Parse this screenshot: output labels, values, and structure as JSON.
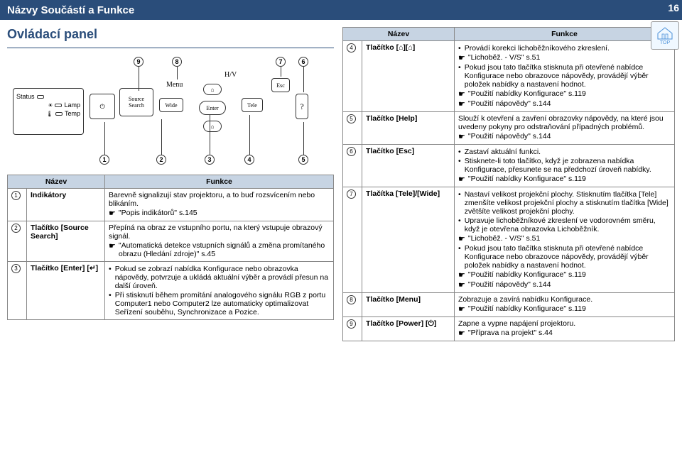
{
  "header": {
    "title": "Názvy Součástí a Funkce",
    "page": "16",
    "top_label": "TOP"
  },
  "section": {
    "title": "Ovládací panel"
  },
  "diagram": {
    "status": "Status",
    "lamp": "Lamp",
    "temp": "Temp",
    "source_search": "Source\nSearch",
    "menu": "Menu",
    "hv": "H/V",
    "wide": "Wide",
    "enter": "Enter",
    "tele": "Tele",
    "esc": "Esc",
    "help": "?"
  },
  "table_headers": {
    "name": "Název",
    "func": "Funkce"
  },
  "left_rows": [
    {
      "num": "1",
      "name": "Indikátory",
      "text": "Barevně signalizují stav projektoru, a to buď rozsvícením nebo blikáním.",
      "ref": "\"Popis indikátorů\" s.145"
    },
    {
      "num": "2",
      "name": "Tlačítko [Source Search]",
      "text": "Přepíná na obraz ze vstupního portu, na který vstupuje obrazový signál.",
      "ref": "\"Automatická detekce vstupních signálů a změna promítaného obrazu (Hledání zdroje)\" s.45"
    },
    {
      "num": "3",
      "name": "Tlačítko [Enter] [↵]",
      "b1": "Pokud se zobrazí nabídka Konfigurace nebo obrazovka nápovědy, potvrzuje a ukládá aktuální výběr a provádí přesun na další úroveň.",
      "b2": "Při stisknutí během promítání analogového signálu RGB z portu Computer1 nebo Computer2 lze automaticky optimalizovat Seřízení souběhu, Synchronizace a Pozice."
    }
  ],
  "right_rows": [
    {
      "num": "4",
      "name": "Tlačítko [⌂][⌂]",
      "b1": "Provádí korekci lichoběžníkového zkreslení.",
      "r1": "\"Lichoběž. - V/S\" s.51",
      "b2": "Pokud jsou tato tlačítka stisknuta při otevřené nabídce Konfigurace nebo obrazovce nápovědy, provádějí výběr položek nabídky a nastavení hodnot.",
      "r2": "\"Použití nabídky Konfigurace\" s.119",
      "r3": "\"Použití nápovědy\" s.144"
    },
    {
      "num": "5",
      "name": "Tlačítko [Help]",
      "text": "Slouží k otevření a zavření obrazovky nápovědy, na které jsou uvedeny pokyny pro odstraňování případných problémů.",
      "r1": "\"Použití nápovědy\" s.144"
    },
    {
      "num": "6",
      "name": "Tlačítko [Esc]",
      "b1": "Zastaví aktuální funkci.",
      "b2": "Stisknete-li toto tlačítko, když je zobrazena nabídka Konfigurace, přesunete se na předchozí úroveň nabídky.",
      "r1": "\"Použití nabídky Konfigurace\" s.119"
    },
    {
      "num": "7",
      "name": "Tlačítka [Tele]/[Wide]",
      "b1": "Nastaví velikost projekční plochy. Stisknutím tlačítka [Tele] zmenšíte velikost projekční plochy a stisknutím tlačítka [Wide] zvětšíte velikost projekční plochy.",
      "b2": "Upravuje lichoběžníkové zkreslení ve vodorovném směru, když je otevřena obrazovka Lichoběžník.",
      "r1": "\"Lichoběž. - V/S\" s.51",
      "b3": "Pokud jsou tato tlačítka stisknuta při otevřené nabídce Konfigurace nebo obrazovce nápovědy, provádějí výběr položek nabídky a nastavení hodnot.",
      "r2": "\"Použití nabídky Konfigurace\" s.119",
      "r3": "\"Použití nápovědy\" s.144"
    },
    {
      "num": "8",
      "name": "Tlačítko [Menu]",
      "text": "Zobrazuje a zavírá nabídku Konfigurace.",
      "r1": "\"Použití nabídky Konfigurace\" s.119"
    },
    {
      "num": "9",
      "name": "Tlačítko [Power] [⏻]",
      "text": "Zapne a vypne napájení projektoru.",
      "r1": "\"Příprava na projekt\" s.44"
    }
  ]
}
